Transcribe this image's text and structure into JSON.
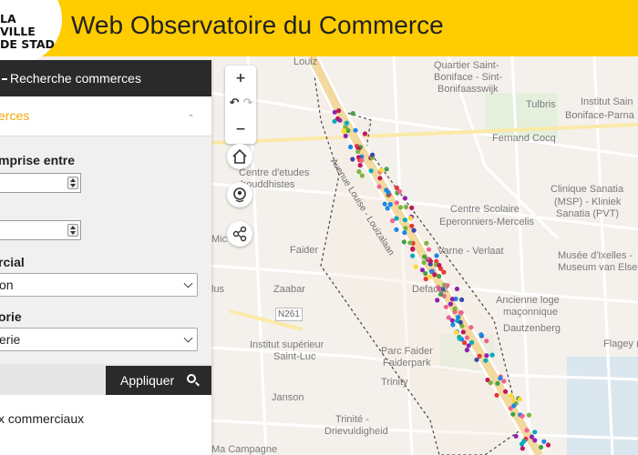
{
  "header": {
    "logo_line1": "LA VILLE",
    "logo_line2": "DE STAD",
    "title": "Web Observatoire du Commerce",
    "background": "#ffcc00"
  },
  "panel": {
    "heading": "Recherche commerces",
    "section_title": "erces",
    "section_toggle": "-",
    "fields": [
      {
        "label": "mprise entre",
        "value": ""
      },
      {
        "label": "",
        "value": ""
      },
      {
        "label": "rcial",
        "value": "on"
      },
      {
        "label": "orie",
        "value": "erie"
      }
    ],
    "apply_label": "Appliquer",
    "footer": "x commerciaux"
  },
  "map": {
    "controls": {
      "zoom_in": "+",
      "zoom_out": "−"
    },
    "labels": [
      "Quartier Saint-",
      "Boniface - Sint-",
      "Bonifaasswijk",
      "Tulbris",
      "Institut Sain",
      "Boniface-Parna",
      "Fernand Cocq",
      "Centre d'etudes",
      "bouddhistes",
      "Centre Scolaire",
      "Eperonniers-Mercelis",
      "Clinique Sanatia",
      "(MSP) - Kliniek",
      "Sanatia (PVT)",
      "Varne - Verlaat",
      "Musée d'Ixelles -",
      "Museum van Elsen",
      "Faider",
      "Zaabar",
      "Defacqz",
      "Ancienne loge",
      "maçonnique",
      "Dautzenberg",
      "Institut supérieur",
      "Saint-Luc",
      "Parc Faider",
      "Faiderpark",
      "Trinity",
      "Flagey (E",
      "Janson",
      "Trinité -",
      "Drievuldigheid",
      "Louiz",
      "lus",
      "N261",
      "Mic",
      "Ma Campagne",
      "Avenue Louise - Louizalaan"
    ]
  }
}
